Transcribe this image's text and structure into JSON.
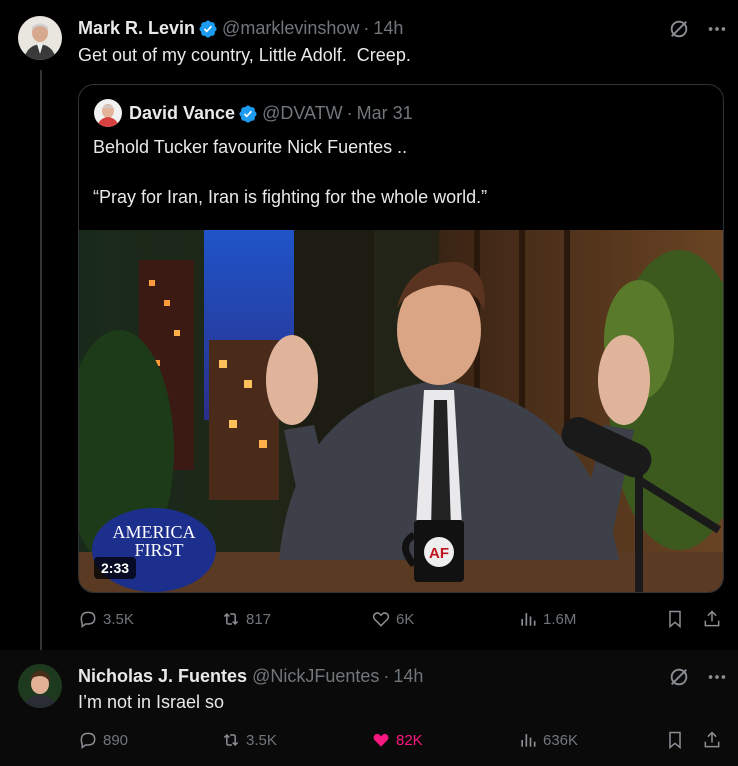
{
  "post1": {
    "author_name": "Mark R. Levin",
    "handle": "@marklevinshow",
    "time": "14h",
    "text": "Get out of my country, Little Adolf.  Creep.",
    "quote": {
      "author_name": "David Vance",
      "handle": "@DVATW",
      "time": "Mar 31",
      "line1": "Behold Tucker favourite Nick Fuentes ..",
      "line2": "“Pray for Iran, Iran is fighting for the whole world.”",
      "video_duration": "2:33",
      "hat_text_1": "AMERICA",
      "hat_text_2": "FIRST",
      "mug_text": "AF"
    },
    "stats": {
      "replies": "3.5K",
      "reposts": "817",
      "likes": "6K",
      "views": "1.6M"
    }
  },
  "post2": {
    "author_name": "Nicholas J. Fuentes",
    "handle": "@NickJFuentes",
    "time": "14h",
    "text": "I’m not in Israel so",
    "stats": {
      "replies": "890",
      "reposts": "3.5K",
      "likes": "82K",
      "views": "636K"
    }
  },
  "separator": "·",
  "colors": {
    "verified": "#1d9bf0",
    "like_active": "#f91880",
    "muted": "#71767b",
    "text": "#e7e9ea",
    "border": "#2f3336"
  },
  "icons": [
    "grok-icon",
    "more-icon",
    "verified-icon",
    "reply-icon",
    "repost-icon",
    "like-icon",
    "views-icon",
    "bookmark-icon",
    "share-icon"
  ]
}
